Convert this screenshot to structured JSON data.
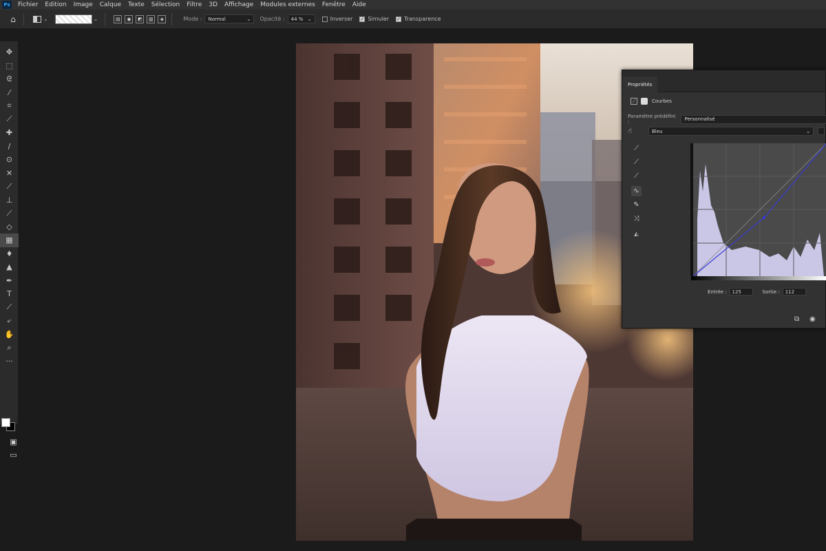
{
  "app": {
    "logo": "Ps"
  },
  "menubar": {
    "items": [
      "Fichier",
      "Edition",
      "Image",
      "Calque",
      "Texte",
      "Sélection",
      "Filtre",
      "3D",
      "Affichage",
      "Modules externes",
      "Fenêtre",
      "Aide"
    ]
  },
  "options": {
    "mode_label": "Mode :",
    "mode_value": "Normal",
    "opacity_label": "Opacité :",
    "opacity_value": "44 %",
    "invert_label": "Inverser",
    "invert_checked": false,
    "dither_label": "Simuler",
    "dither_checked": true,
    "transparency_label": "Transparence",
    "transparency_checked": true
  },
  "toolbar": {
    "tools": [
      "move-icon",
      "marquee-icon",
      "lasso-icon",
      "magic-wand-icon",
      "crop-icon",
      "eyedropper-icon",
      "healing-brush-icon",
      "brush-icon",
      "clone-stamp-icon",
      "history-brush-icon",
      "eraser-icon",
      "gradient-icon",
      "blur-icon",
      "dodge-icon",
      "pen-icon",
      "type-icon",
      "path-selection-icon",
      "shape-icon",
      "hand-icon",
      "zoom-icon",
      "more-tools-icon"
    ],
    "selected_tool": "gradient-icon"
  },
  "properties": {
    "tab_label": "Propriétés",
    "adjustment_label": "Courbes",
    "preset_label": "Paramètre prédéfini :",
    "preset_value": "Personnalisé",
    "channel_value": "Bleu",
    "input_label": "Entrée :",
    "input_value": "125",
    "output_label": "Sortie :",
    "output_value": "112"
  },
  "colors": {
    "ui_dark": "#1b1b1b",
    "panel": "#323232",
    "curve_line": "#3a3ad6",
    "histogram": "#c9c6e6"
  }
}
